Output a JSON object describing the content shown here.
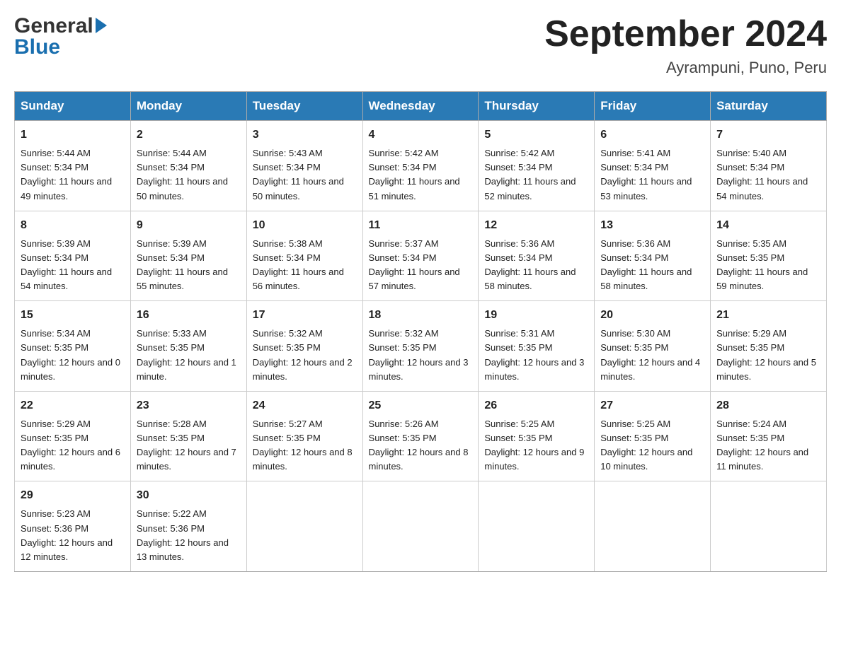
{
  "header": {
    "logo_general": "General",
    "logo_blue": "Blue",
    "month_title": "September 2024",
    "subtitle": "Ayrampuni, Puno, Peru"
  },
  "calendar": {
    "days_of_week": [
      "Sunday",
      "Monday",
      "Tuesday",
      "Wednesday",
      "Thursday",
      "Friday",
      "Saturday"
    ],
    "weeks": [
      [
        {
          "day": "1",
          "sunrise": "5:44 AM",
          "sunset": "5:34 PM",
          "daylight": "11 hours and 49 minutes."
        },
        {
          "day": "2",
          "sunrise": "5:44 AM",
          "sunset": "5:34 PM",
          "daylight": "11 hours and 50 minutes."
        },
        {
          "day": "3",
          "sunrise": "5:43 AM",
          "sunset": "5:34 PM",
          "daylight": "11 hours and 50 minutes."
        },
        {
          "day": "4",
          "sunrise": "5:42 AM",
          "sunset": "5:34 PM",
          "daylight": "11 hours and 51 minutes."
        },
        {
          "day": "5",
          "sunrise": "5:42 AM",
          "sunset": "5:34 PM",
          "daylight": "11 hours and 52 minutes."
        },
        {
          "day": "6",
          "sunrise": "5:41 AM",
          "sunset": "5:34 PM",
          "daylight": "11 hours and 53 minutes."
        },
        {
          "day": "7",
          "sunrise": "5:40 AM",
          "sunset": "5:34 PM",
          "daylight": "11 hours and 54 minutes."
        }
      ],
      [
        {
          "day": "8",
          "sunrise": "5:39 AM",
          "sunset": "5:34 PM",
          "daylight": "11 hours and 54 minutes."
        },
        {
          "day": "9",
          "sunrise": "5:39 AM",
          "sunset": "5:34 PM",
          "daylight": "11 hours and 55 minutes."
        },
        {
          "day": "10",
          "sunrise": "5:38 AM",
          "sunset": "5:34 PM",
          "daylight": "11 hours and 56 minutes."
        },
        {
          "day": "11",
          "sunrise": "5:37 AM",
          "sunset": "5:34 PM",
          "daylight": "11 hours and 57 minutes."
        },
        {
          "day": "12",
          "sunrise": "5:36 AM",
          "sunset": "5:34 PM",
          "daylight": "11 hours and 58 minutes."
        },
        {
          "day": "13",
          "sunrise": "5:36 AM",
          "sunset": "5:34 PM",
          "daylight": "11 hours and 58 minutes."
        },
        {
          "day": "14",
          "sunrise": "5:35 AM",
          "sunset": "5:35 PM",
          "daylight": "11 hours and 59 minutes."
        }
      ],
      [
        {
          "day": "15",
          "sunrise": "5:34 AM",
          "sunset": "5:35 PM",
          "daylight": "12 hours and 0 minutes."
        },
        {
          "day": "16",
          "sunrise": "5:33 AM",
          "sunset": "5:35 PM",
          "daylight": "12 hours and 1 minute."
        },
        {
          "day": "17",
          "sunrise": "5:32 AM",
          "sunset": "5:35 PM",
          "daylight": "12 hours and 2 minutes."
        },
        {
          "day": "18",
          "sunrise": "5:32 AM",
          "sunset": "5:35 PM",
          "daylight": "12 hours and 3 minutes."
        },
        {
          "day": "19",
          "sunrise": "5:31 AM",
          "sunset": "5:35 PM",
          "daylight": "12 hours and 3 minutes."
        },
        {
          "day": "20",
          "sunrise": "5:30 AM",
          "sunset": "5:35 PM",
          "daylight": "12 hours and 4 minutes."
        },
        {
          "day": "21",
          "sunrise": "5:29 AM",
          "sunset": "5:35 PM",
          "daylight": "12 hours and 5 minutes."
        }
      ],
      [
        {
          "day": "22",
          "sunrise": "5:29 AM",
          "sunset": "5:35 PM",
          "daylight": "12 hours and 6 minutes."
        },
        {
          "day": "23",
          "sunrise": "5:28 AM",
          "sunset": "5:35 PM",
          "daylight": "12 hours and 7 minutes."
        },
        {
          "day": "24",
          "sunrise": "5:27 AM",
          "sunset": "5:35 PM",
          "daylight": "12 hours and 8 minutes."
        },
        {
          "day": "25",
          "sunrise": "5:26 AM",
          "sunset": "5:35 PM",
          "daylight": "12 hours and 8 minutes."
        },
        {
          "day": "26",
          "sunrise": "5:25 AM",
          "sunset": "5:35 PM",
          "daylight": "12 hours and 9 minutes."
        },
        {
          "day": "27",
          "sunrise": "5:25 AM",
          "sunset": "5:35 PM",
          "daylight": "12 hours and 10 minutes."
        },
        {
          "day": "28",
          "sunrise": "5:24 AM",
          "sunset": "5:35 PM",
          "daylight": "12 hours and 11 minutes."
        }
      ],
      [
        {
          "day": "29",
          "sunrise": "5:23 AM",
          "sunset": "5:36 PM",
          "daylight": "12 hours and 12 minutes."
        },
        {
          "day": "30",
          "sunrise": "5:22 AM",
          "sunset": "5:36 PM",
          "daylight": "12 hours and 13 minutes."
        },
        null,
        null,
        null,
        null,
        null
      ]
    ],
    "labels": {
      "sunrise": "Sunrise: ",
      "sunset": "Sunset: ",
      "daylight": "Daylight: "
    }
  }
}
